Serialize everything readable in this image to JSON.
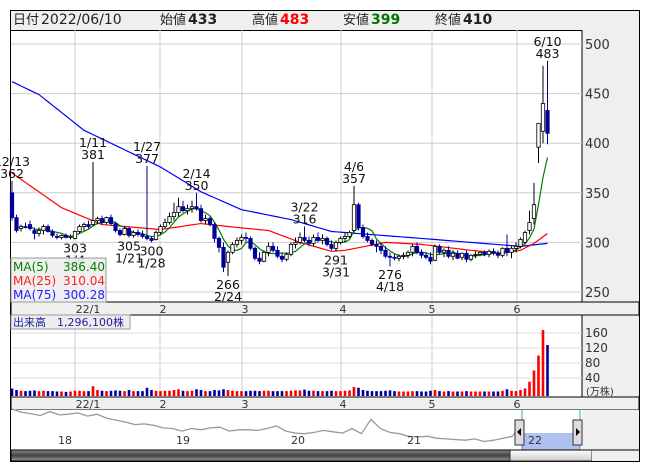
{
  "header": {
    "date_label": "日付",
    "date": "2022/06/10",
    "open_label": "始値",
    "open": "433",
    "high_label": "高値",
    "high": "483",
    "low_label": "安値",
    "low": "399",
    "close_label": "終値",
    "close": "410"
  },
  "colors": {
    "up_fill": "#ffffff",
    "down_fill": "#000099",
    "ma5": "#008000",
    "ma25": "#ff0000",
    "ma75": "#0000ff",
    "vol_up": "#ff0000",
    "vol_down": "#000099",
    "vol_flat": "#888888",
    "high_text": "#ff0000",
    "low_text": "#007700"
  },
  "legend": {
    "ma5_label": "MA(5)",
    "ma5_value": "386.40",
    "ma25_label": "MA(25)",
    "ma25_value": "310.04",
    "ma75_label": "MA(75)",
    "ma75_value": "300.28"
  },
  "volume_label": {
    "label": "出来高",
    "value": "1,296,100株"
  },
  "price_axis": {
    "ticks": [
      "500",
      "450",
      "400",
      "350",
      "300",
      "250"
    ]
  },
  "volume_axis": {
    "ticks": [
      "160",
      "120",
      "80",
      "40"
    ],
    "unit": "(万株)"
  },
  "month_axis": {
    "labels": [
      "22/1",
      "2",
      "3",
      "4",
      "5",
      "6"
    ]
  },
  "navigator": {
    "year_labels": [
      "18",
      "19",
      "20",
      "21",
      "22"
    ],
    "series": [
      300,
      295,
      293,
      290,
      296,
      291,
      292,
      294,
      289,
      292,
      286,
      283,
      280,
      276,
      277,
      275,
      271,
      270,
      266,
      270,
      268,
      271,
      272,
      266,
      268,
      268,
      267,
      270,
      274,
      266,
      263,
      262,
      264,
      267,
      265,
      263,
      270,
      262,
      284,
      270,
      264,
      262,
      258,
      257,
      258,
      255,
      254,
      253,
      252,
      254,
      250,
      252,
      255,
      258,
      280
    ]
  },
  "annotations": [
    {
      "date": "12/13",
      "value": "362",
      "idx": 0,
      "kind": "high"
    },
    {
      "date": "1/11",
      "value": "381",
      "idx": 18,
      "kind": "high"
    },
    {
      "date": "1/27",
      "value": "377",
      "idx": 30,
      "kind": "high"
    },
    {
      "date": "2/14",
      "value": "350",
      "idx": 41,
      "kind": "high"
    },
    {
      "date": "3/22",
      "value": "316",
      "idx": 65,
      "kind": "high"
    },
    {
      "date": "4/6",
      "value": "357",
      "idx": 76,
      "kind": "high"
    },
    {
      "date": "6/10",
      "value": "483",
      "idx": 119,
      "kind": "high"
    },
    {
      "date": "1/4",
      "value": "303",
      "idx": 14,
      "kind": "low"
    },
    {
      "date": "1/21",
      "value": "305",
      "idx": 26,
      "kind": "low"
    },
    {
      "date": "1/28",
      "value": "300",
      "idx": 31,
      "kind": "low"
    },
    {
      "date": "2/24",
      "value": "266",
      "idx": 48,
      "kind": "low"
    },
    {
      "date": "3/31",
      "value": "291",
      "idx": 72,
      "kind": "low"
    },
    {
      "date": "4/18",
      "value": "276",
      "idx": 84,
      "kind": "low"
    }
  ],
  "chart_data": {
    "type": "candlestick",
    "ylim": [
      250,
      500
    ],
    "volume_ylim": [
      0,
      160
    ],
    "ohlc": [
      [
        350,
        362,
        322,
        325
      ],
      [
        325,
        328,
        310,
        312
      ],
      [
        314,
        318,
        311,
        316
      ],
      [
        316,
        320,
        314,
        315
      ],
      [
        318,
        322,
        312,
        314
      ],
      [
        312,
        315,
        303,
        309
      ],
      [
        309,
        315,
        306,
        312
      ],
      [
        312,
        318,
        308,
        316
      ],
      [
        316,
        318,
        310,
        311
      ],
      [
        311,
        313,
        305,
        307
      ],
      [
        306,
        309,
        303,
        305
      ],
      [
        305,
        308,
        303,
        307
      ],
      [
        307,
        309,
        304,
        305
      ],
      [
        305,
        308,
        303,
        306
      ],
      [
        304,
        312,
        303,
        311
      ],
      [
        311,
        318,
        309,
        316
      ],
      [
        316,
        320,
        312,
        318
      ],
      [
        318,
        322,
        314,
        316
      ],
      [
        318,
        381,
        316,
        322
      ],
      [
        322,
        326,
        318,
        324
      ],
      [
        324,
        327,
        318,
        320
      ],
      [
        320,
        326,
        318,
        325
      ],
      [
        325,
        328,
        317,
        319
      ],
      [
        319,
        321,
        310,
        312
      ],
      [
        312,
        314,
        306,
        308
      ],
      [
        308,
        316,
        307,
        314
      ],
      [
        314,
        316,
        305,
        307
      ],
      [
        307,
        312,
        305,
        310
      ],
      [
        310,
        313,
        306,
        308
      ],
      [
        308,
        312,
        304,
        306
      ],
      [
        306,
        377,
        302,
        304
      ],
      [
        304,
        306,
        300,
        302
      ],
      [
        303,
        312,
        302,
        310
      ],
      [
        310,
        318,
        308,
        316
      ],
      [
        316,
        324,
        314,
        320
      ],
      [
        320,
        330,
        318,
        326
      ],
      [
        326,
        340,
        322,
        330
      ],
      [
        330,
        345,
        326,
        336
      ],
      [
        336,
        342,
        330,
        332
      ],
      [
        332,
        338,
        328,
        334
      ],
      [
        334,
        342,
        330,
        336
      ],
      [
        336,
        350,
        332,
        334
      ],
      [
        334,
        338,
        320,
        322
      ],
      [
        322,
        328,
        318,
        324
      ],
      [
        324,
        326,
        316,
        318
      ],
      [
        318,
        320,
        300,
        304
      ],
      [
        304,
        306,
        290,
        295
      ],
      [
        295,
        300,
        270,
        275
      ],
      [
        280,
        292,
        266,
        290
      ],
      [
        290,
        300,
        288,
        298
      ],
      [
        298,
        305,
        295,
        302
      ],
      [
        302,
        308,
        298,
        305
      ],
      [
        305,
        310,
        300,
        304
      ],
      [
        304,
        306,
        292,
        294
      ],
      [
        294,
        296,
        282,
        284
      ],
      [
        284,
        290,
        278,
        281
      ],
      [
        281,
        292,
        280,
        290
      ],
      [
        290,
        300,
        286,
        296
      ],
      [
        296,
        300,
        290,
        292
      ],
      [
        292,
        296,
        284,
        286
      ],
      [
        286,
        290,
        280,
        283
      ],
      [
        283,
        290,
        281,
        288
      ],
      [
        288,
        300,
        286,
        298
      ],
      [
        298,
        305,
        294,
        300
      ],
      [
        300,
        310,
        298,
        305
      ],
      [
        305,
        316,
        300,
        302
      ],
      [
        302,
        306,
        296,
        299
      ],
      [
        299,
        308,
        296,
        305
      ],
      [
        305,
        310,
        300,
        302
      ],
      [
        302,
        308,
        298,
        304
      ],
      [
        304,
        306,
        296,
        298
      ],
      [
        298,
        302,
        292,
        294
      ],
      [
        294,
        302,
        291,
        300
      ],
      [
        300,
        306,
        298,
        304
      ],
      [
        304,
        310,
        300,
        306
      ],
      [
        306,
        312,
        304,
        310
      ],
      [
        312,
        357,
        310,
        338
      ],
      [
        338,
        340,
        312,
        315
      ],
      [
        315,
        318,
        304,
        306
      ],
      [
        306,
        310,
        300,
        302
      ],
      [
        302,
        304,
        296,
        298
      ],
      [
        298,
        302,
        290,
        296
      ],
      [
        296,
        300,
        288,
        292
      ],
      [
        292,
        296,
        284,
        286
      ],
      [
        286,
        290,
        276,
        285
      ],
      [
        285,
        288,
        282,
        284
      ],
      [
        284,
        288,
        281,
        286
      ],
      [
        286,
        290,
        283,
        287
      ],
      [
        287,
        292,
        284,
        290
      ],
      [
        290,
        298,
        286,
        296
      ],
      [
        296,
        300,
        288,
        290
      ],
      [
        290,
        293,
        284,
        287
      ],
      [
        287,
        290,
        283,
        285
      ],
      [
        285,
        290,
        278,
        281
      ],
      [
        282,
        298,
        281,
        296
      ],
      [
        296,
        298,
        288,
        290
      ],
      [
        290,
        294,
        285,
        292
      ],
      [
        292,
        296,
        284,
        286
      ],
      [
        286,
        292,
        282,
        289
      ],
      [
        289,
        292,
        283,
        284
      ],
      [
        285,
        290,
        282,
        289
      ],
      [
        289,
        292,
        280,
        283
      ],
      [
        283,
        288,
        281,
        287
      ],
      [
        287,
        291,
        284,
        288
      ],
      [
        288,
        291,
        286,
        290
      ],
      [
        290,
        292,
        286,
        288
      ],
      [
        288,
        293,
        285,
        291
      ],
      [
        291,
        294,
        287,
        289
      ],
      [
        289,
        292,
        284,
        287
      ],
      [
        287,
        295,
        285,
        294
      ],
      [
        294,
        308,
        286,
        290
      ],
      [
        290,
        296,
        284,
        294
      ],
      [
        294,
        300,
        290,
        296
      ],
      [
        296,
        305,
        294,
        303
      ],
      [
        300,
        312,
        298,
        310
      ],
      [
        312,
        332,
        308,
        320
      ],
      [
        324,
        360,
        318,
        338
      ],
      [
        396,
        420,
        380,
        420
      ],
      [
        412,
        478,
        400,
        440
      ],
      [
        433,
        483,
        399,
        410
      ]
    ],
    "volume": [
      12,
      8,
      6,
      5,
      6,
      7,
      5,
      6,
      5,
      5,
      4,
      4,
      3,
      4,
      6,
      6,
      5,
      5,
      18,
      8,
      6,
      5,
      6,
      7,
      6,
      5,
      8,
      5,
      5,
      5,
      14,
      8,
      6,
      5,
      6,
      6,
      8,
      10,
      6,
      5,
      6,
      10,
      8,
      5,
      5,
      8,
      7,
      10,
      8,
      6,
      5,
      5,
      5,
      6,
      6,
      5,
      6,
      6,
      5,
      5,
      5,
      5,
      6,
      7,
      7,
      9,
      6,
      6,
      5,
      5,
      5,
      6,
      5,
      5,
      6,
      7,
      16,
      14,
      8,
      6,
      5,
      5,
      5,
      6,
      7,
      5,
      4,
      4,
      4,
      5,
      5,
      4,
      4,
      6,
      8,
      5,
      4,
      5,
      4,
      4,
      4,
      5,
      4,
      4,
      4,
      4,
      4,
      4,
      4,
      6,
      10,
      6,
      5,
      8,
      12,
      30,
      60,
      100,
      168,
      128
    ],
    "ma25": [
      [
        0,
        370
      ],
      [
        11,
        335
      ],
      [
        20,
        318
      ],
      [
        33,
        313
      ],
      [
        42,
        319
      ],
      [
        48,
        316
      ],
      [
        57,
        312
      ],
      [
        64,
        300
      ],
      [
        71,
        291
      ],
      [
        74,
        292
      ],
      [
        83,
        300
      ],
      [
        91,
        298
      ],
      [
        102,
        292
      ],
      [
        109,
        289
      ],
      [
        113,
        292
      ],
      [
        116,
        299
      ],
      [
        119,
        309
      ]
    ],
    "ma75": [
      [
        0,
        462
      ],
      [
        6,
        449
      ],
      [
        16,
        413
      ],
      [
        33,
        376
      ],
      [
        42,
        351
      ],
      [
        51,
        333
      ],
      [
        62,
        323
      ],
      [
        71,
        311
      ],
      [
        91,
        304
      ],
      [
        113,
        296
      ],
      [
        119,
        299
      ]
    ]
  }
}
